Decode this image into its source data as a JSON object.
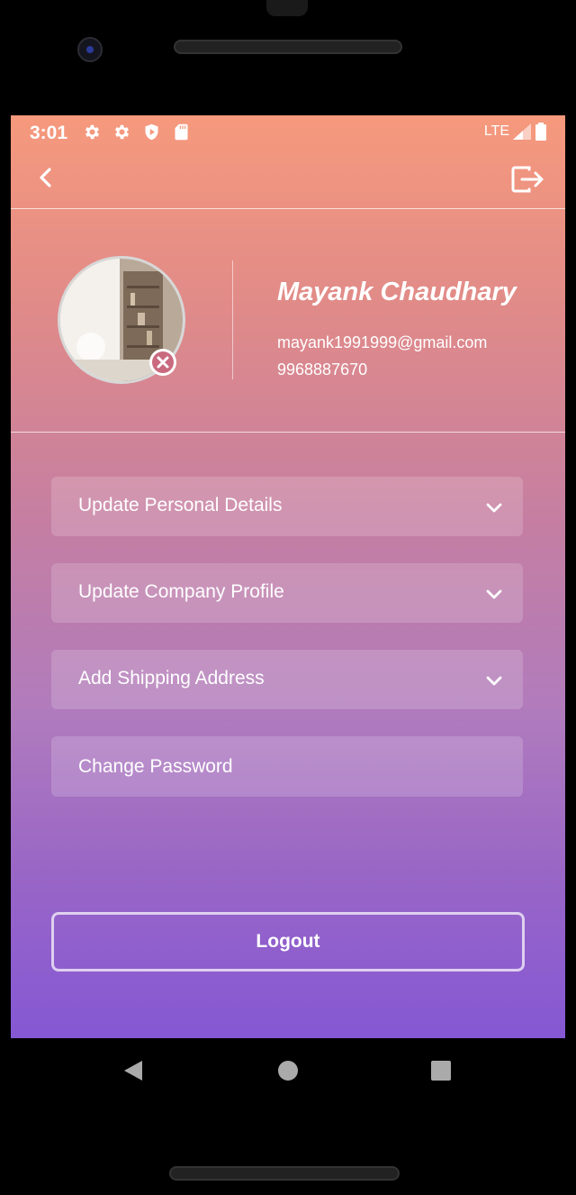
{
  "status_bar": {
    "time": "3:01",
    "network": "LTE",
    "icons": [
      "gear-icon",
      "gear-icon",
      "shield-icon",
      "sd-card-icon"
    ]
  },
  "app_bar": {
    "back_icon": "chevron-left-icon",
    "logout_icon": "logout-icon"
  },
  "profile": {
    "name": "Mayank Chaudhary",
    "email": "mayank1991999@gmail.com",
    "phone": "9968887670"
  },
  "menu": {
    "items": [
      {
        "label": "Update Personal Details",
        "expandable": true
      },
      {
        "label": "Update Company Profile",
        "expandable": true
      },
      {
        "label": "Add Shipping Address",
        "expandable": true
      },
      {
        "label": "Change Password",
        "expandable": false
      }
    ]
  },
  "logout_button": "Logout",
  "colors": {
    "gradient_top": "#f6997c",
    "gradient_bottom": "#8558d4",
    "remove_badge": "#c96a7e"
  }
}
